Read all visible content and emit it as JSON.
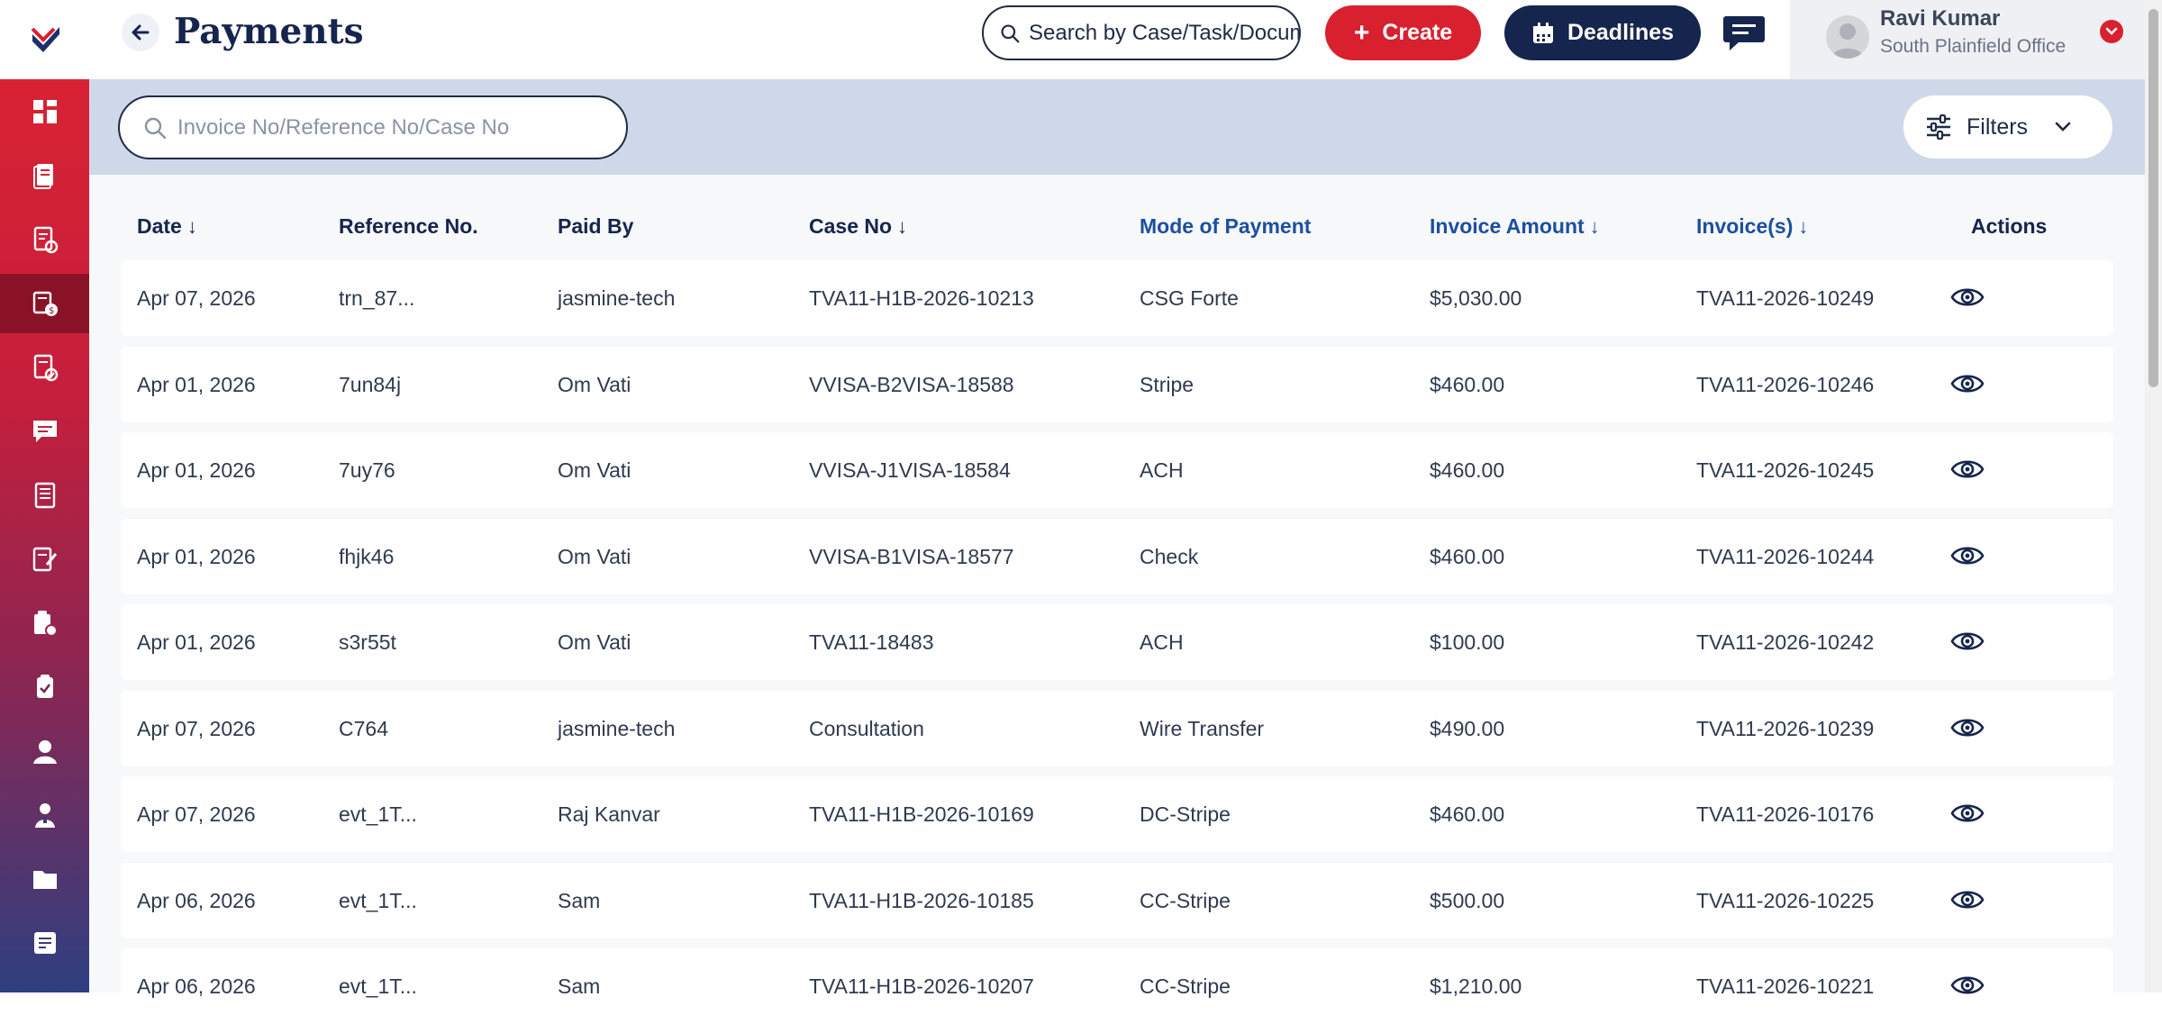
{
  "header": {
    "title": "Payments",
    "global_search_placeholder": "Search by Case/Task/Document",
    "create_label": "Create",
    "deadlines_label": "Deadlines",
    "user": {
      "name": "Ravi Kumar",
      "office": "South Plainfield Office"
    }
  },
  "sidebar": {
    "items": [
      {
        "icon": "dashboard-icon"
      },
      {
        "icon": "cases-icon"
      },
      {
        "icon": "tasks-icon"
      },
      {
        "icon": "payments-icon",
        "active": true
      },
      {
        "icon": "invoices-icon"
      },
      {
        "icon": "messages-icon"
      },
      {
        "icon": "documents-icon"
      },
      {
        "icon": "forms-icon"
      },
      {
        "icon": "checklist-icon"
      },
      {
        "icon": "clipboard-icon"
      },
      {
        "icon": "contacts-icon"
      },
      {
        "icon": "users-icon"
      },
      {
        "icon": "folder-icon"
      },
      {
        "icon": "notes-icon"
      }
    ]
  },
  "list": {
    "search_placeholder": "Invoice No/Reference No/Case No",
    "filters_label": "Filters"
  },
  "table": {
    "columns": [
      "Date",
      "Reference No.",
      "Paid By",
      "Case No",
      "Mode of Payment",
      "Invoice Amount",
      "Invoice(s)",
      "Actions"
    ],
    "sort_arrow": "↓",
    "rows": [
      [
        "Apr 07, 2026",
        "trn_87...",
        "jasmine-tech",
        "TVA11-H1B-2026-10213",
        "CSG Forte",
        "$5,030.00",
        "TVA11-2026-10249"
      ],
      [
        "Apr 01, 2026",
        "7un84j",
        "Om Vati",
        "VVISA-B2VISA-18588",
        "Stripe",
        "$460.00",
        "TVA11-2026-10246"
      ],
      [
        "Apr 01, 2026",
        "7uy76",
        "Om Vati",
        "VVISA-J1VISA-18584",
        "ACH",
        "$460.00",
        "TVA11-2026-10245"
      ],
      [
        "Apr 01, 2026",
        "fhjk46",
        "Om Vati",
        "VVISA-B1VISA-18577",
        "Check",
        "$460.00",
        "TVA11-2026-10244"
      ],
      [
        "Apr 01, 2026",
        "s3r55t",
        "Om Vati",
        "TVA11-18483",
        "ACH",
        "$100.00",
        "TVA11-2026-10242"
      ],
      [
        "Apr 07, 2026",
        "C764",
        "jasmine-tech",
        "Consultation",
        "Wire Transfer",
        "$490.00",
        "TVA11-2026-10239"
      ],
      [
        "Apr 07, 2026",
        "evt_1T...",
        "Raj Kanvar",
        "TVA11-H1B-2026-10169",
        "DC-Stripe",
        "$460.00",
        "TVA11-2026-10176"
      ],
      [
        "Apr 06, 2026",
        "evt_1T...",
        "Sam",
        "TVA11-H1B-2026-10185",
        "CC-Stripe",
        "$500.00",
        "TVA11-2026-10225"
      ],
      [
        "Apr 06, 2026",
        "evt_1T...",
        "Sam",
        "TVA11-H1B-2026-10207",
        "CC-Stripe",
        "$1,210.00",
        "TVA11-2026-10221"
      ]
    ]
  },
  "colors": {
    "brand_red": "#d8202f",
    "navy": "#16254d",
    "header_blue": "#1b4fa0",
    "filter_band": "#cfd8e9"
  }
}
